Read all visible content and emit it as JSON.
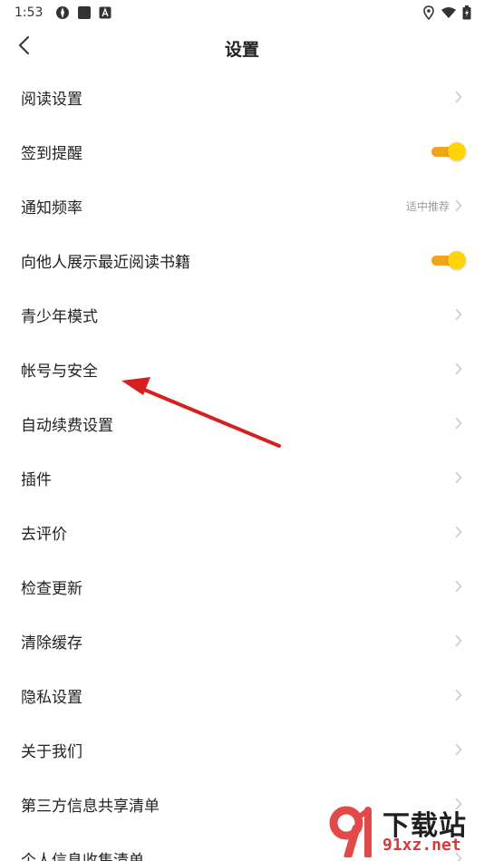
{
  "status_bar": {
    "time": "1:53",
    "left_icons": [
      "compass-icon",
      "square-app-icon",
      "font-app-icon"
    ],
    "right_icons": [
      "location-icon",
      "wifi-icon",
      "battery-charging-icon"
    ]
  },
  "header": {
    "title": "设置",
    "back_icon": "chevron-left-icon"
  },
  "settings": {
    "items": [
      {
        "label": "阅读设置",
        "type": "nav"
      },
      {
        "label": "签到提醒",
        "type": "toggle",
        "on": true
      },
      {
        "label": "通知频率",
        "type": "nav",
        "value": "适中推荐"
      },
      {
        "label": "向他人展示最近阅读书籍",
        "type": "toggle",
        "on": true
      },
      {
        "label": "青少年模式",
        "type": "nav"
      },
      {
        "label": "帐号与安全",
        "type": "nav"
      },
      {
        "label": "自动续费设置",
        "type": "nav"
      },
      {
        "label": "插件",
        "type": "nav"
      },
      {
        "label": "去评价",
        "type": "nav"
      },
      {
        "label": "检查更新",
        "type": "nav"
      },
      {
        "label": "清除缓存",
        "type": "nav"
      },
      {
        "label": "隐私设置",
        "type": "nav"
      },
      {
        "label": "关于我们",
        "type": "nav"
      },
      {
        "label": "第三方信息共享清单",
        "type": "nav"
      },
      {
        "label": "个人信息收集清单",
        "type": "nav"
      }
    ]
  },
  "colors": {
    "toggle_track": "#f0a41a",
    "toggle_knob": "#ffd50a",
    "annotation_arrow": "#d62020",
    "chevron": "#c4c4c4"
  },
  "watermark": {
    "text_primary": "下载站",
    "text_secondary": "91xz.net",
    "logo_icon": "91-logo-icon"
  }
}
